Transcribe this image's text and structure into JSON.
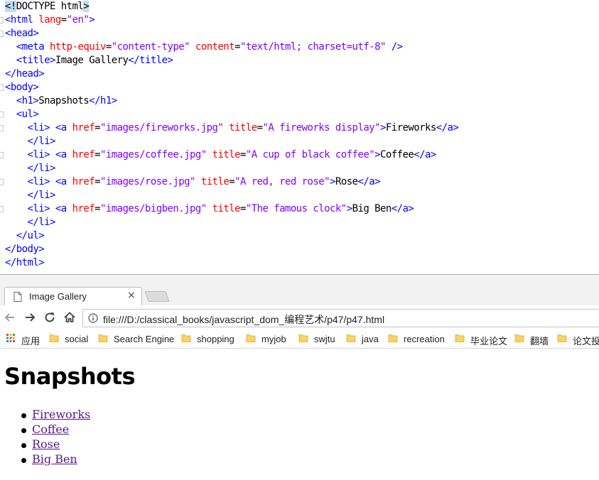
{
  "editor": {
    "lines": [
      {
        "fold": false,
        "tokens": [
          {
            "c": "doc",
            "t": "<!"
          },
          {
            "c": "txt",
            "t": "DOCTYPE html"
          },
          {
            "c": "doc",
            "t": ">"
          }
        ]
      },
      {
        "fold": true,
        "tokens": [
          {
            "c": "tag",
            "t": "<html "
          },
          {
            "c": "attr",
            "t": "lang"
          },
          {
            "c": "txt",
            "t": "="
          },
          {
            "c": "val",
            "t": "\"en\""
          },
          {
            "c": "tag",
            "t": ">"
          }
        ]
      },
      {
        "fold": true,
        "tokens": [
          {
            "c": "tag",
            "t": "<head>"
          }
        ]
      },
      {
        "fold": false,
        "tokens": [
          {
            "c": "txt",
            "t": "  "
          },
          {
            "c": "tag",
            "t": "<meta "
          },
          {
            "c": "attr",
            "t": "http-equiv"
          },
          {
            "c": "txt",
            "t": "="
          },
          {
            "c": "val",
            "t": "\"content-type\""
          },
          {
            "c": "txt",
            "t": " "
          },
          {
            "c": "attr",
            "t": "content"
          },
          {
            "c": "txt",
            "t": "="
          },
          {
            "c": "val",
            "t": "\"text/html; charset=utf-8\""
          },
          {
            "c": "txt",
            "t": " "
          },
          {
            "c": "tag",
            "t": "/>"
          }
        ]
      },
      {
        "fold": false,
        "tokens": [
          {
            "c": "txt",
            "t": "  "
          },
          {
            "c": "tag",
            "t": "<title>"
          },
          {
            "c": "txt",
            "t": "Image Gallery"
          },
          {
            "c": "tag",
            "t": "</title>"
          }
        ]
      },
      {
        "fold": false,
        "tokens": [
          {
            "c": "tag",
            "t": "</head>"
          }
        ]
      },
      {
        "fold": true,
        "tokens": [
          {
            "c": "tag",
            "t": "<body>"
          }
        ]
      },
      {
        "fold": false,
        "tokens": [
          {
            "c": "txt",
            "t": "  "
          },
          {
            "c": "tag",
            "t": "<h1>"
          },
          {
            "c": "txt",
            "t": "Snapshots"
          },
          {
            "c": "tag",
            "t": "</h1>"
          }
        ]
      },
      {
        "fold": true,
        "tokens": [
          {
            "c": "txt",
            "t": "  "
          },
          {
            "c": "tag",
            "t": "<ul>"
          }
        ]
      },
      {
        "fold": true,
        "tokens": [
          {
            "c": "txt",
            "t": "    "
          },
          {
            "c": "tag",
            "t": "<li>"
          },
          {
            "c": "txt",
            "t": " "
          },
          {
            "c": "tag",
            "t": "<a "
          },
          {
            "c": "attr",
            "t": "href"
          },
          {
            "c": "txt",
            "t": "="
          },
          {
            "c": "val",
            "t": "\"images/fireworks.jpg\""
          },
          {
            "c": "txt",
            "t": " "
          },
          {
            "c": "attr",
            "t": "title"
          },
          {
            "c": "txt",
            "t": "="
          },
          {
            "c": "val",
            "t": "\"A fireworks display\""
          },
          {
            "c": "tag",
            "t": ">"
          },
          {
            "c": "txt",
            "t": "Fireworks"
          },
          {
            "c": "tag",
            "t": "</a>"
          }
        ]
      },
      {
        "fold": false,
        "tokens": [
          {
            "c": "txt",
            "t": "    "
          },
          {
            "c": "tag",
            "t": "</li>"
          }
        ]
      },
      {
        "fold": true,
        "tokens": [
          {
            "c": "txt",
            "t": "    "
          },
          {
            "c": "tag",
            "t": "<li>"
          },
          {
            "c": "txt",
            "t": " "
          },
          {
            "c": "tag",
            "t": "<a "
          },
          {
            "c": "attr",
            "t": "href"
          },
          {
            "c": "txt",
            "t": "="
          },
          {
            "c": "val",
            "t": "\"images/coffee.jpg\""
          },
          {
            "c": "txt",
            "t": " "
          },
          {
            "c": "attr",
            "t": "title"
          },
          {
            "c": "txt",
            "t": "="
          },
          {
            "c": "val",
            "t": "\"A cup of black coffee\""
          },
          {
            "c": "tag",
            "t": ">"
          },
          {
            "c": "txt",
            "t": "Coffee"
          },
          {
            "c": "tag",
            "t": "</a>"
          }
        ]
      },
      {
        "fold": false,
        "tokens": [
          {
            "c": "txt",
            "t": "    "
          },
          {
            "c": "tag",
            "t": "</li>"
          }
        ]
      },
      {
        "fold": true,
        "tokens": [
          {
            "c": "txt",
            "t": "    "
          },
          {
            "c": "tag",
            "t": "<li>"
          },
          {
            "c": "txt",
            "t": " "
          },
          {
            "c": "tag",
            "t": "<a "
          },
          {
            "c": "attr",
            "t": "href"
          },
          {
            "c": "txt",
            "t": "="
          },
          {
            "c": "val",
            "t": "\"images/rose.jpg\""
          },
          {
            "c": "txt",
            "t": " "
          },
          {
            "c": "attr",
            "t": "title"
          },
          {
            "c": "txt",
            "t": "="
          },
          {
            "c": "val",
            "t": "\"A red, red rose\""
          },
          {
            "c": "tag",
            "t": ">"
          },
          {
            "c": "txt",
            "t": "Rose"
          },
          {
            "c": "tag",
            "t": "</a>"
          }
        ]
      },
      {
        "fold": false,
        "tokens": [
          {
            "c": "txt",
            "t": "    "
          },
          {
            "c": "tag",
            "t": "</li>"
          }
        ]
      },
      {
        "fold": true,
        "tokens": [
          {
            "c": "txt",
            "t": "    "
          },
          {
            "c": "tag",
            "t": "<li>"
          },
          {
            "c": "txt",
            "t": " "
          },
          {
            "c": "tag",
            "t": "<a "
          },
          {
            "c": "attr",
            "t": "href"
          },
          {
            "c": "txt",
            "t": "="
          },
          {
            "c": "val",
            "t": "\"images/bigben.jpg\""
          },
          {
            "c": "txt",
            "t": " "
          },
          {
            "c": "attr",
            "t": "title"
          },
          {
            "c": "txt",
            "t": "="
          },
          {
            "c": "val",
            "t": "\"The famous clock\""
          },
          {
            "c": "tag",
            "t": ">"
          },
          {
            "c": "txt",
            "t": "Big Ben"
          },
          {
            "c": "tag",
            "t": "</a>"
          }
        ]
      },
      {
        "fold": false,
        "tokens": [
          {
            "c": "txt",
            "t": "    "
          },
          {
            "c": "tag",
            "t": "</li>"
          }
        ]
      },
      {
        "fold": false,
        "tokens": [
          {
            "c": "txt",
            "t": "  "
          },
          {
            "c": "tag",
            "t": "</ul>"
          }
        ]
      },
      {
        "fold": false,
        "tokens": [
          {
            "c": "tag",
            "t": "</body>"
          }
        ]
      },
      {
        "fold": false,
        "tokens": [
          {
            "c": "tag",
            "t": "</html>"
          }
        ]
      }
    ]
  },
  "browser": {
    "tab": {
      "title": "Image Gallery",
      "close_glyph": "×",
      "icon": "page-icon"
    },
    "nav": {
      "back_icon": "arrow-left-icon",
      "forward_icon": "arrow-right-icon",
      "reload_icon": "reload-icon",
      "home_icon": "home-icon"
    },
    "address": {
      "icon": "info-icon",
      "url": "file:///D:/classical_books/javascript_dom_编程艺术/p47/p47.html"
    },
    "bookmarks": [
      {
        "label": "应用",
        "icon": "apps-icon"
      },
      {
        "label": "social",
        "icon": "folder-icon"
      },
      {
        "label": "Search Engine",
        "icon": "folder-icon"
      },
      {
        "label": "shopping",
        "icon": "folder-icon"
      },
      {
        "label": "myjob",
        "icon": "folder-icon"
      },
      {
        "label": "swjtu",
        "icon": "folder-icon"
      },
      {
        "label": "java",
        "icon": "folder-icon"
      },
      {
        "label": "recreation",
        "icon": "folder-icon"
      },
      {
        "label": "毕业论文",
        "icon": "folder-icon"
      },
      {
        "label": "翻墙",
        "icon": "folder-icon"
      },
      {
        "label": "论文投",
        "icon": "folder-icon"
      }
    ],
    "colors": {
      "link_visited": "#551a8b",
      "folder": "#f7d463"
    }
  },
  "page": {
    "heading": "Snapshots",
    "links": [
      {
        "label": "Fireworks"
      },
      {
        "label": "Coffee"
      },
      {
        "label": "Rose"
      },
      {
        "label": "Big Ben"
      }
    ]
  }
}
